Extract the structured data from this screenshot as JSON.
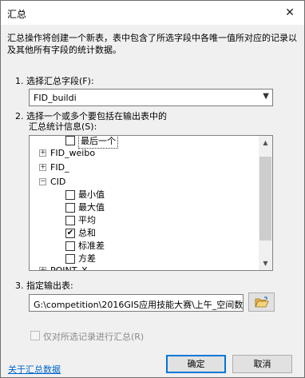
{
  "window": {
    "title": "汇总",
    "close_glyph": "✕"
  },
  "description": "汇总操作将创建一个新表，表中包含了所选字段中各唯一值所对应的记录以及其他所有字段的统计数据。",
  "step1": {
    "label": "1. 选择汇总字段(F):",
    "value": "FID_buildi"
  },
  "step2": {
    "label_line1": "2. 选择一个或多个要包括在输出表中的",
    "label_line2": "汇总统计信息(S):",
    "items": [
      {
        "type": "stat",
        "label": "最后一个",
        "checked": false,
        "selected": true
      },
      {
        "type": "field",
        "label": "FID_weibo",
        "expanded": false
      },
      {
        "type": "field",
        "label": "FID_",
        "expanded": false
      },
      {
        "type": "field",
        "label": "CID",
        "expanded": true
      },
      {
        "type": "stat",
        "label": "最小值",
        "checked": false
      },
      {
        "type": "stat",
        "label": "最大值",
        "checked": false
      },
      {
        "type": "stat",
        "label": "平均",
        "checked": false
      },
      {
        "type": "stat",
        "label": "总和",
        "checked": true
      },
      {
        "type": "stat",
        "label": "标准差",
        "checked": false
      },
      {
        "type": "stat",
        "label": "方差",
        "checked": false
      },
      {
        "type": "field",
        "label": "POINT_X",
        "expanded": false
      }
    ]
  },
  "step3": {
    "label": "3. 指定输出表:",
    "value": "G:\\competition\\2016GIS应用技能大赛\\上午_空间数"
  },
  "selected_only": {
    "label": "仅对所选记录进行汇总(R)",
    "checked": false,
    "enabled": false
  },
  "footer": {
    "help_link": "关于汇总数据",
    "ok_label": "确定",
    "cancel_label": "取消"
  }
}
